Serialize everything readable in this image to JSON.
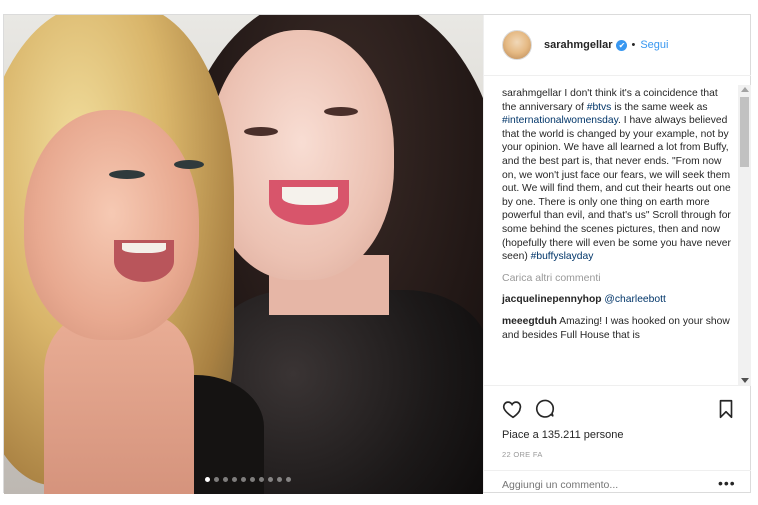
{
  "header": {
    "username": "sarahmgellar",
    "verified_icon": "✔",
    "separator": "•",
    "follow_label": "Segui"
  },
  "caption": {
    "username": "sarahmgellar",
    "part1": " I don't think it's a coincidence that the anniversary of ",
    "tag1": "#btvs",
    "part2": " is the same week as ",
    "tag2": "#internationalwomensday",
    "part3": ". I have always believed that the world is changed by your example, not by your opinion. We have all learned a lot from Buffy, and the best part is, that never ends. \"From now on, we won't just face our fears, we will seek them out. We will find them, and cut their hearts out one by one. There is only one thing on earth more powerful than evil, and that's us\" Scroll through for some behind the scenes pictures, then and now (hopefully there will even be some you have never seen) ",
    "tag3": "#buffyslayday"
  },
  "load_more": "Carica altri commenti",
  "comments": [
    {
      "username": "jacquelinepennyhop",
      "text": " @charleebott"
    },
    {
      "username": "meeegtduh",
      "text": " Amazing! I was hooked on your show and besides Full House that is"
    }
  ],
  "actions": {
    "likes": "Piace a 135.211 persone",
    "time": "22 ORE FA",
    "add_comment_placeholder": "Aggiungi un commento...",
    "more_options": "•••"
  },
  "carousel": {
    "slides": 10,
    "active_index": 0
  }
}
